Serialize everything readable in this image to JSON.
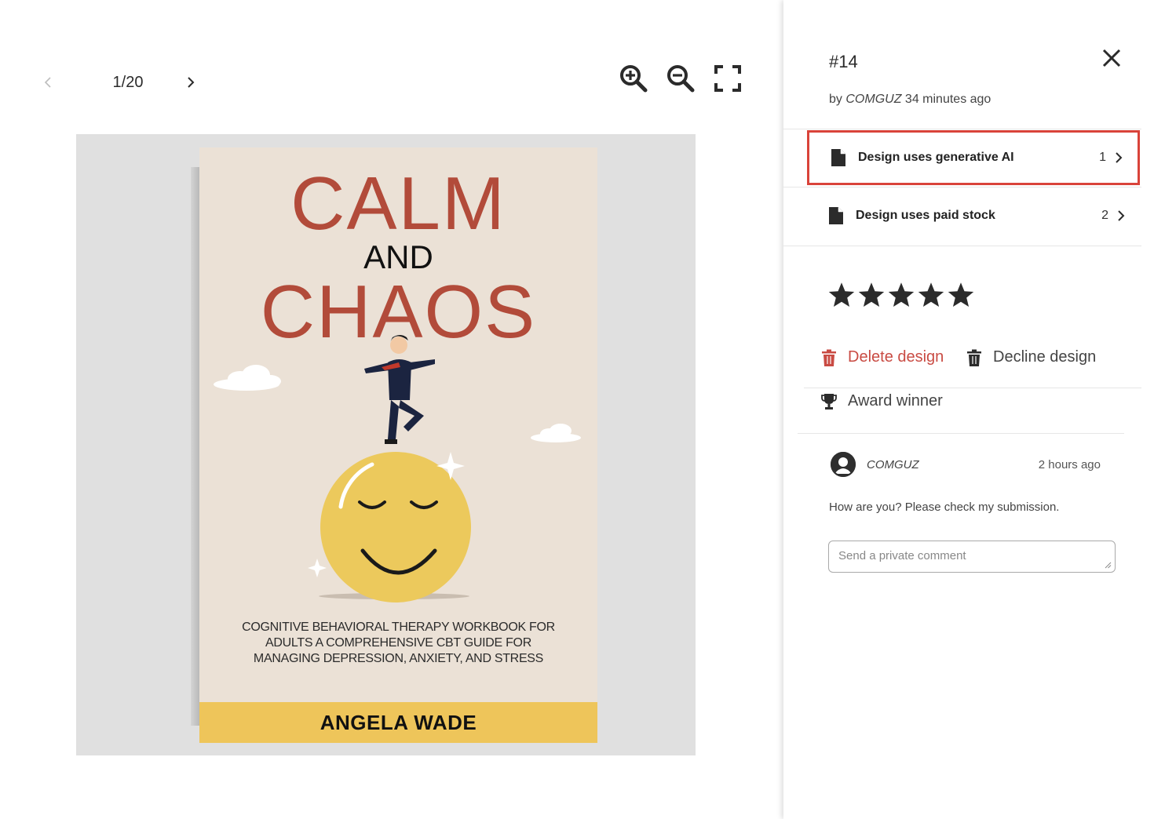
{
  "viewer": {
    "page_counter": "1/20",
    "prev_icon": "chevron-left-icon",
    "next_icon": "chevron-right-icon",
    "tools": [
      "zoom-in-icon",
      "zoom-out-icon",
      "fullscreen-icon"
    ]
  },
  "cover": {
    "title_line1": "CALM",
    "title_line2": "AND",
    "title_line3": "CHAOS",
    "subtitle": "COGNITIVE BEHAVIORAL THERAPY WORKBOOK FOR ADULTS A COMPREHENSIVE CBT GUIDE FOR MANAGING DEPRESSION, ANXIETY, AND STRESS",
    "author": "ANGELA WADE",
    "colors": {
      "background": "#ebe1d6",
      "title": "#b24b3a",
      "author_band": "#eec55a",
      "smiley": "#ecc95c"
    }
  },
  "panel": {
    "entry_id": "#14",
    "byline_prefix": "by",
    "designer": "COMGUZ",
    "submitted_ago": "34 minutes ago",
    "flags": [
      {
        "label": "Design uses generative AI",
        "count": "1",
        "highlighted": true
      },
      {
        "label": "Design uses paid stock",
        "count": "2",
        "highlighted": false
      }
    ],
    "rating": {
      "stars_filled": 5,
      "stars_total": 5,
      "color": "#2b2b2b"
    },
    "actions": {
      "delete": "Delete design",
      "decline": "Decline design",
      "award": "Award winner"
    },
    "comment": {
      "author": "COMGUZ",
      "time": "2 hours ago",
      "text": "How are you? Please check my submission."
    },
    "comment_input": {
      "placeholder": "Send a private comment",
      "value": ""
    },
    "colors": {
      "danger": "#c94b43",
      "highlight_border": "#d9433a"
    }
  }
}
